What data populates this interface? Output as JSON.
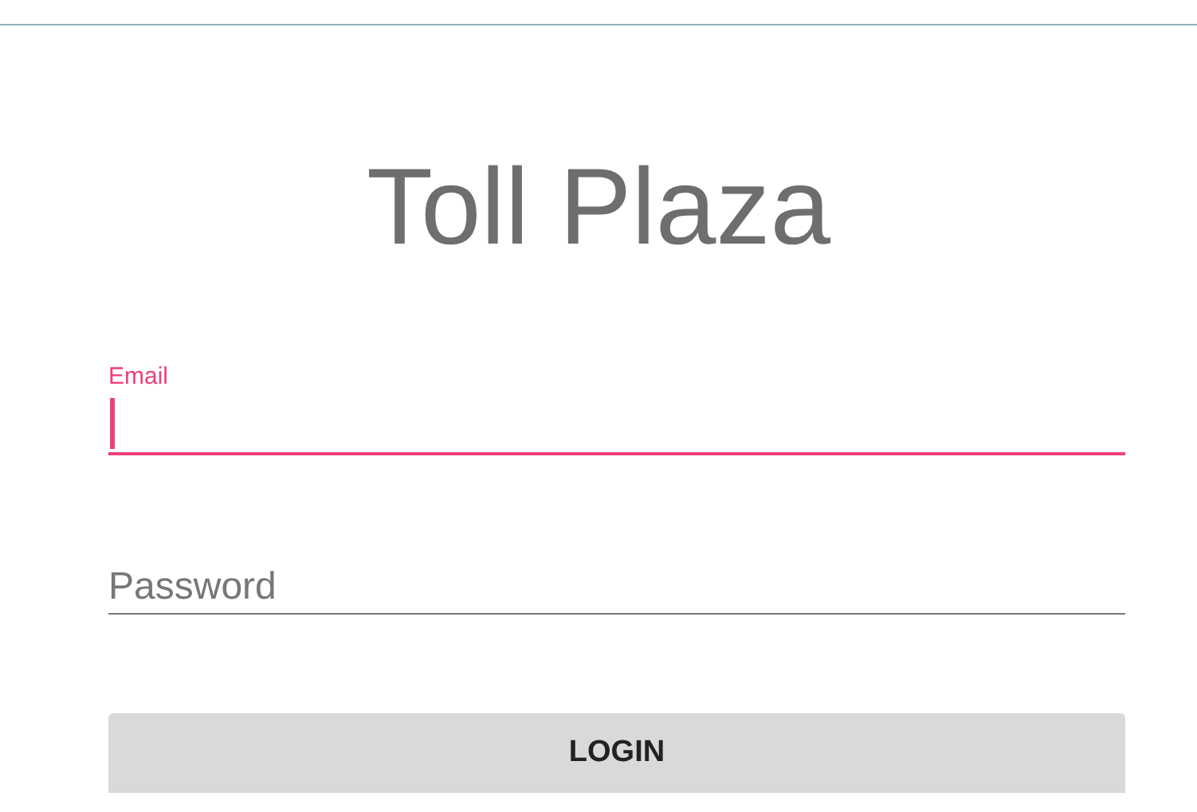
{
  "title": "Toll Plaza",
  "fields": [
    {
      "label": "Email",
      "focused": true
    },
    {
      "placeholder": "Password",
      "focused": false
    }
  ],
  "button": {
    "label": "LOGIN"
  }
}
